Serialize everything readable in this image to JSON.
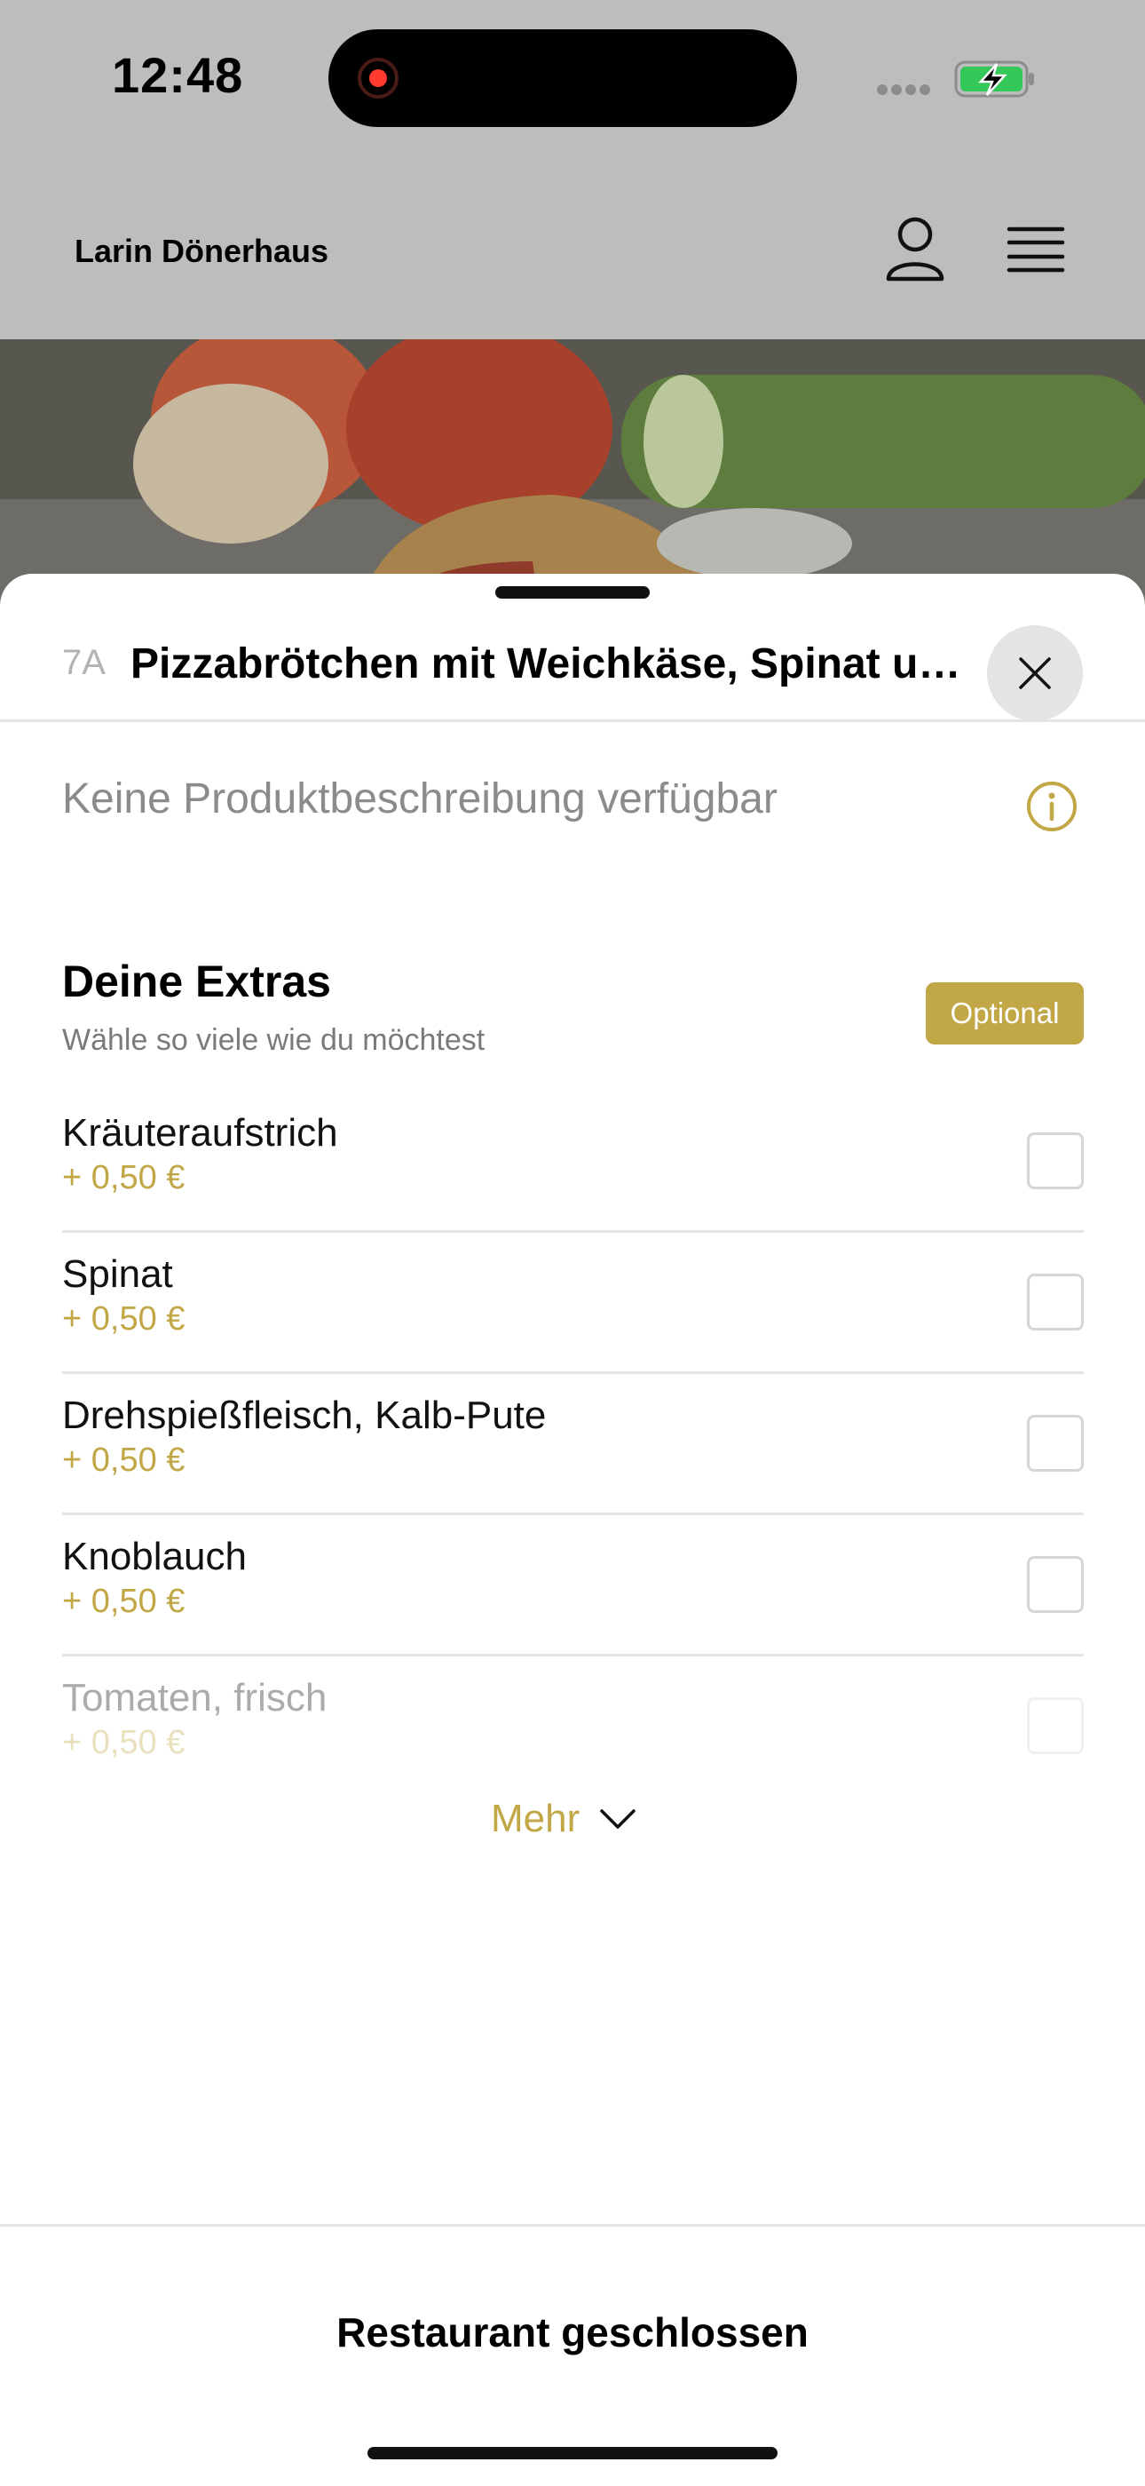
{
  "status_bar": {
    "time": "12:48",
    "recording": true,
    "battery_state": "charging",
    "colors": {
      "recording_dot": "#ff3b30",
      "battery_fill": "#34c759"
    }
  },
  "header": {
    "brand": "Larin Dönerhaus",
    "icons": [
      "user-icon",
      "menu-icon"
    ]
  },
  "hero": {
    "image": "food photo: pizza roll with tomatoes, cucumber and onion"
  },
  "product": {
    "code": "7A",
    "title": "Pizzabrötchen mit Weichkäse, Spinat und Drehspießfleisch",
    "description": "Keine Produktbeschreibung verfügbar"
  },
  "extras": {
    "title": "Deine Extras",
    "subtitle": "Wähle so viele wie du möchtest",
    "badge": "Optional",
    "options": [
      {
        "name": "Kräuteraufstrich",
        "price": "+ 0,50 €",
        "checked": false
      },
      {
        "name": "Spinat",
        "price": "+ 0,50 €",
        "checked": false
      },
      {
        "name": "Drehspießfleisch, Kalb-Pute",
        "price": "+ 0,50 €",
        "checked": false
      },
      {
        "name": "Knoblauch",
        "price": "+ 0,50 €",
        "checked": false
      },
      {
        "name": "Tomaten, frisch",
        "price": "+ 0,50 €",
        "checked": false
      }
    ],
    "more_label": "Mehr"
  },
  "footer": {
    "status": "Restaurant geschlossen"
  },
  "theme": {
    "accent": "#c2a747",
    "divider": "#e4e4e4",
    "overlay": "#bdbdbd"
  }
}
